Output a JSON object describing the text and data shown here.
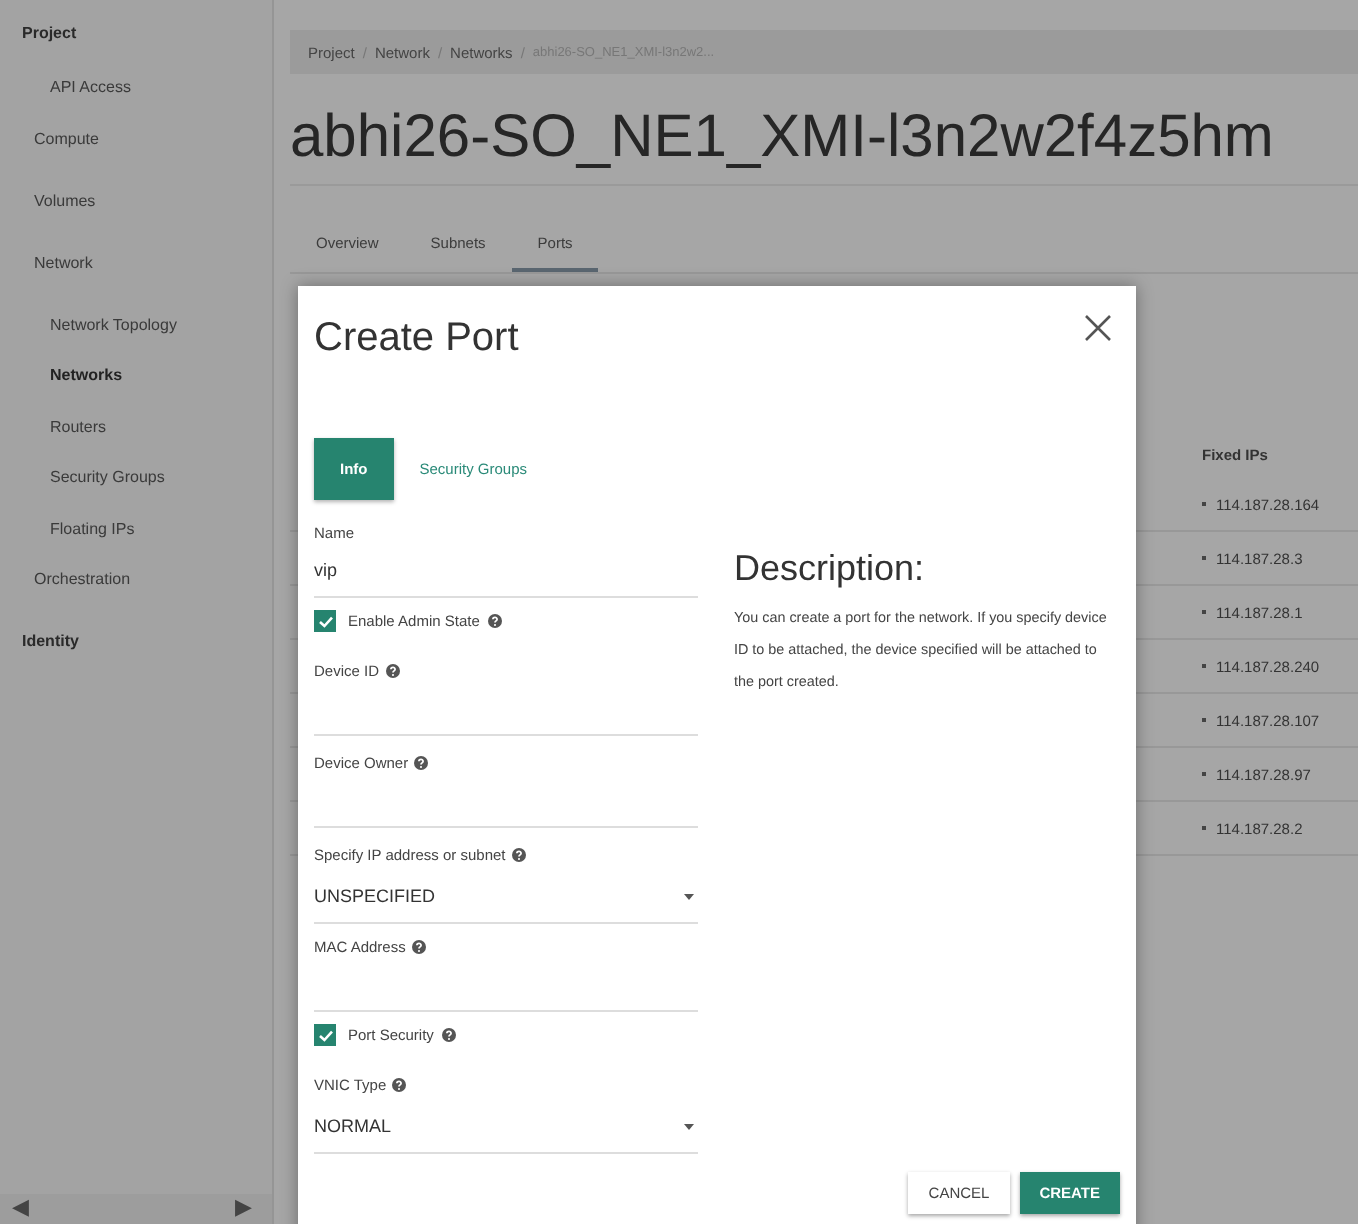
{
  "sidebar": {
    "sections": [
      {
        "label": "Project",
        "children": [
          {
            "label": "API Access",
            "kind": "link",
            "selected": false
          },
          {
            "label": "Compute",
            "kind": "group",
            "selected": false
          },
          {
            "label": "Volumes",
            "kind": "group",
            "selected": false
          },
          {
            "label": "Network",
            "kind": "group",
            "selected": false,
            "children": [
              {
                "label": "Network Topology",
                "kind": "link",
                "selected": false
              },
              {
                "label": "Networks",
                "kind": "link",
                "selected": true
              },
              {
                "label": "Routers",
                "kind": "link",
                "selected": false
              },
              {
                "label": "Security Groups",
                "kind": "link",
                "selected": false
              },
              {
                "label": "Floating IPs",
                "kind": "link",
                "selected": false
              }
            ]
          },
          {
            "label": "Orchestration",
            "kind": "group",
            "selected": false
          }
        ]
      },
      {
        "label": "Identity"
      }
    ],
    "scroll_left": "◀",
    "scroll_right": "▶"
  },
  "breadcrumb": [
    {
      "label": "Project",
      "separator": "/"
    },
    {
      "label": "Network",
      "separator": "/"
    },
    {
      "label": "Networks",
      "separator": "/"
    },
    {
      "label": "abhi26-SO_NE1_XMI-l3n2w2..."
    }
  ],
  "page_title": "abhi26-SO_NE1_XMI-l3n2w2f4z5hm",
  "tabs": [
    {
      "label": "Overview",
      "selected": false
    },
    {
      "label": "Subnets",
      "selected": false
    },
    {
      "label": "Ports",
      "selected": true
    }
  ],
  "table": {
    "columns": [
      "Fixed IPs"
    ],
    "rows": [
      [
        "114.187.28.164"
      ],
      [
        "114.187.28.3"
      ],
      [
        "114.187.28.1"
      ],
      [
        "114.187.28.240"
      ],
      [
        "114.187.28.107"
      ],
      [
        "114.187.28.97"
      ],
      [
        "114.187.28.2"
      ]
    ]
  },
  "modal": {
    "title": "Create Port",
    "tabs": [
      {
        "label": "Info",
        "selected": true
      },
      {
        "label": "Security Groups",
        "selected": false
      }
    ],
    "fields": [
      {
        "kind": "text",
        "label": "Name",
        "value": "vip",
        "help": false
      },
      {
        "kind": "checkbox",
        "label": "Enable Admin State",
        "checked": true,
        "help": true
      },
      {
        "kind": "text",
        "label": "Device ID",
        "help": true
      },
      {
        "kind": "text",
        "label": "Device Owner",
        "help": true
      },
      {
        "kind": "select",
        "label": "Specify IP address or subnet",
        "value": "UNSPECIFIED",
        "help": true
      },
      {
        "kind": "text",
        "label": "MAC Address",
        "help": true
      },
      {
        "kind": "checkbox",
        "label": "Port Security",
        "checked": true,
        "help": true
      },
      {
        "kind": "select",
        "label": "VNIC Type",
        "value": "NORMAL",
        "help": true
      }
    ],
    "description_title": "Description:",
    "description": "You can create a port for the network. If you specify device ID to be attached, the device specified will be attached to the port created.",
    "buttons": [
      {
        "label": "CANCEL",
        "kind": "secondary"
      },
      {
        "label": "CREATE",
        "kind": "primary"
      }
    ]
  }
}
